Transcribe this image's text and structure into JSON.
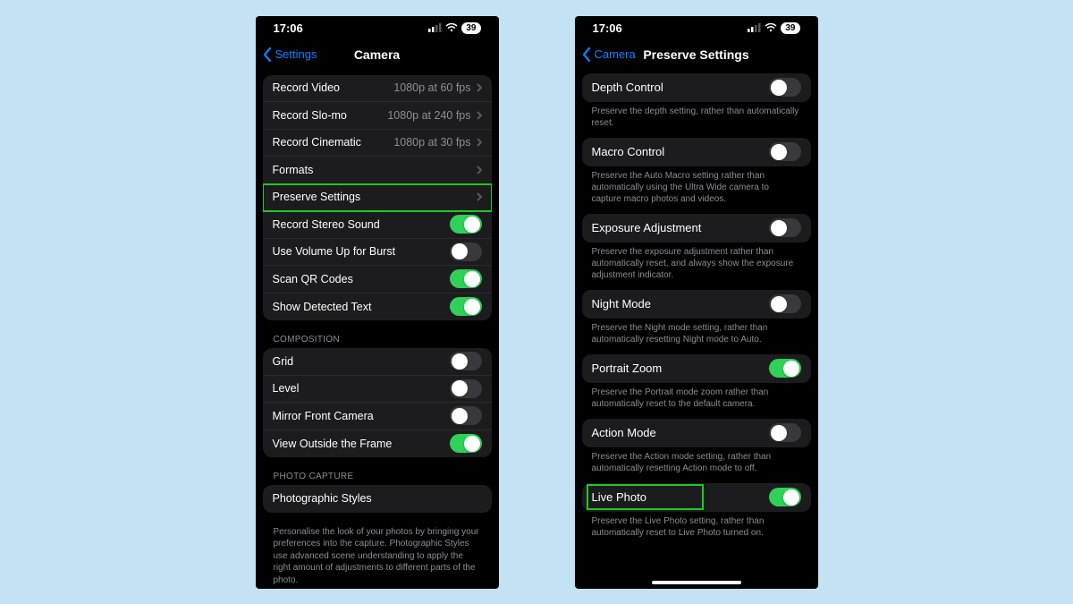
{
  "status": {
    "time": "17:06",
    "battery": "39"
  },
  "left": {
    "back": "Settings",
    "title": "Camera",
    "rows": {
      "recordVideo": {
        "label": "Record Video",
        "value": "1080p at 60 fps"
      },
      "recordSlomo": {
        "label": "Record Slo-mo",
        "value": "1080p at 240 fps"
      },
      "recordCinematic": {
        "label": "Record Cinematic",
        "value": "1080p at 30 fps"
      },
      "formats": {
        "label": "Formats"
      },
      "preserve": {
        "label": "Preserve Settings"
      },
      "stereo": {
        "label": "Record Stereo Sound"
      },
      "volumeBurst": {
        "label": "Use Volume Up for Burst"
      },
      "qr": {
        "label": "Scan QR Codes"
      },
      "detectedText": {
        "label": "Show Detected Text"
      }
    },
    "sectionComposition": "COMPOSITION",
    "composition": {
      "grid": {
        "label": "Grid"
      },
      "level": {
        "label": "Level"
      },
      "mirror": {
        "label": "Mirror Front Camera"
      },
      "outside": {
        "label": "View Outside the Frame"
      }
    },
    "sectionPhotoCapture": "PHOTO CAPTURE",
    "photoCapture": {
      "styles": {
        "label": "Photographic Styles"
      }
    },
    "stylesFooter": "Personalise the look of your photos by bringing your preferences into the capture. Photographic Styles use advanced scene understanding to apply the right amount of adjustments to different parts of the photo."
  },
  "right": {
    "back": "Camera",
    "title": "Preserve Settings",
    "items": {
      "depth": {
        "label": "Depth Control",
        "desc": "Preserve the depth setting, rather than automatically reset."
      },
      "macro": {
        "label": "Macro Control",
        "desc": "Preserve the Auto Macro setting rather than automatically using the Ultra Wide camera to capture macro photos and videos."
      },
      "exposure": {
        "label": "Exposure Adjustment",
        "desc": "Preserve the exposure adjustment rather than automatically reset, and always show the exposure adjustment indicator."
      },
      "night": {
        "label": "Night Mode",
        "desc": "Preserve the Night mode setting, rather than automatically resetting Night mode to Auto."
      },
      "portrait": {
        "label": "Portrait Zoom",
        "desc": "Preserve the Portrait mode zoom rather than automatically reset to the default camera."
      },
      "action": {
        "label": "Action Mode",
        "desc": "Preserve the Action mode setting, rather than automatically resetting Action mode to off."
      },
      "live": {
        "label": "Live Photo",
        "desc": "Preserve the Live Photo setting, rather than automatically reset to Live Photo turned on."
      }
    }
  }
}
